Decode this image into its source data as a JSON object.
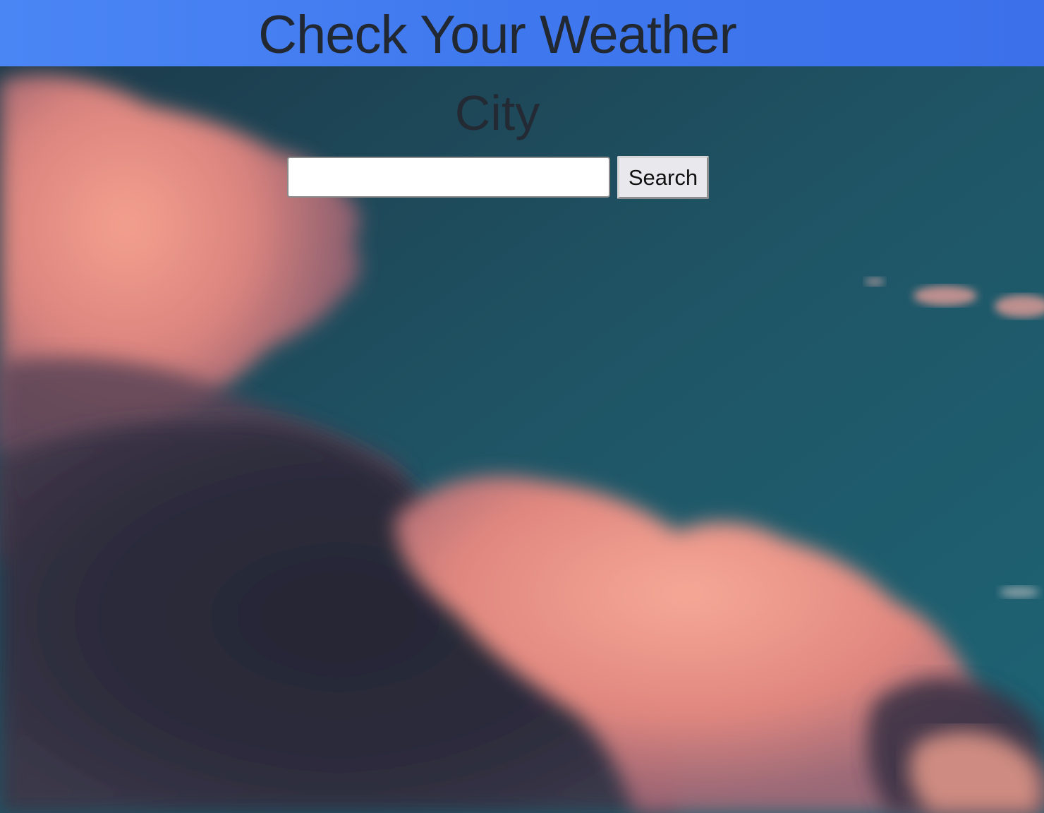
{
  "header": {
    "title": "Check Your Weather",
    "background_color": "#4b86f5",
    "text_color": "#222831"
  },
  "main": {
    "city_label": "City",
    "search": {
      "value": "",
      "placeholder": ""
    },
    "search_button_label": "Search"
  },
  "background": {
    "image_subject": "pink-sunset-clouds-photo",
    "sky_color": "#1f5a68",
    "cloud_color": "#e8877e",
    "shadow_cloud_color": "#2f2c3c"
  }
}
